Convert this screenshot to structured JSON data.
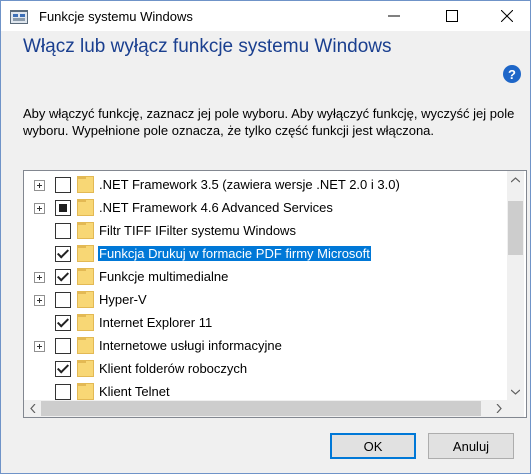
{
  "window": {
    "title": "Funkcje systemu Windows",
    "controls": {
      "minimize": "—",
      "maximize": "☐",
      "close": "✕"
    }
  },
  "header": {
    "heading": "Włącz lub wyłącz funkcje systemu Windows",
    "help": "?"
  },
  "description": "Aby włączyć funkcję, zaznacz jej pole wyboru. Aby wyłączyć funkcję, wyczyść jej pole wyboru. Wypełnione pole oznacza, że tylko część funkcji jest włączona.",
  "features": [
    {
      "label": ".NET Framework 3.5 (zawiera wersje .NET 2.0 i 3.0)",
      "expandable": true,
      "state": "unchecked",
      "selected": false
    },
    {
      "label": ".NET Framework 4.6 Advanced Services",
      "expandable": true,
      "state": "partial",
      "selected": false
    },
    {
      "label": "Filtr TIFF IFilter systemu Windows",
      "expandable": false,
      "state": "unchecked",
      "selected": false
    },
    {
      "label": "Funkcja Drukuj w formacie PDF firmy Microsoft",
      "expandable": false,
      "state": "checked",
      "selected": true
    },
    {
      "label": "Funkcje multimedialne",
      "expandable": true,
      "state": "checked",
      "selected": false
    },
    {
      "label": "Hyper-V",
      "expandable": true,
      "state": "unchecked",
      "selected": false
    },
    {
      "label": "Internet Explorer 11",
      "expandable": false,
      "state": "checked",
      "selected": false
    },
    {
      "label": "Internetowe usługi informacyjne",
      "expandable": true,
      "state": "unchecked",
      "selected": false
    },
    {
      "label": "Klient folderów roboczych",
      "expandable": false,
      "state": "checked",
      "selected": false
    },
    {
      "label": "Klient Telnet",
      "expandable": false,
      "state": "unchecked",
      "selected": false
    }
  ],
  "scroll": {
    "up": "^",
    "down": "v",
    "left": "<",
    "right": ">"
  },
  "buttons": {
    "ok": "OK",
    "cancel": "Anuluj"
  },
  "colors": {
    "accent": "#0078d7",
    "heading": "#1a3f8f",
    "folder": "#f8d775"
  },
  "icons": {
    "app": "windows-features-icon",
    "help": "help-icon",
    "folder": "folder-icon"
  }
}
